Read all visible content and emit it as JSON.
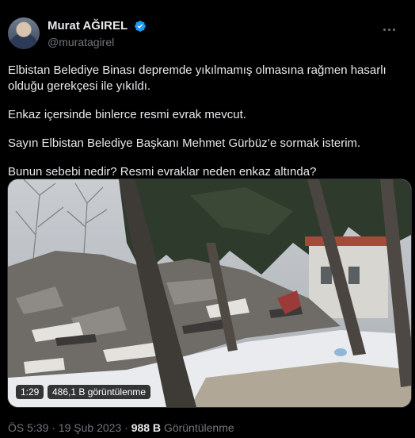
{
  "tweet": {
    "author_name": "Murat AĞIREL",
    "author_handle": "@muratagirel",
    "paragraphs": [
      "Elbistan Belediye Binası depremde yıkılmamış olmasına rağmen hasarlı olduğu gerekçesi ile yıkıldı.",
      "Enkaz içersinde binlerce resmi evrak mevcut.",
      "Sayın Elbistan Belediye Başkanı Mehmet Gürbüz’e sormak isterim.",
      "Bunun sebebi nedir? Resmi evraklar neden enkaz altında?"
    ],
    "video": {
      "duration": "1:29",
      "views": "486,1 B görüntülenme"
    },
    "meta": {
      "time": "ÖS 5:39",
      "separator": "·",
      "date": "19 Şub 2023",
      "views_count": "988 B",
      "views_label": "Görüntülenme"
    }
  },
  "icons": {
    "verified": "verified-badge-icon",
    "more": "more-options-icon"
  },
  "colors": {
    "background": "#000000",
    "text": "#e7e9ea",
    "secondary": "#71767b",
    "verified": "#1d9bf0"
  }
}
